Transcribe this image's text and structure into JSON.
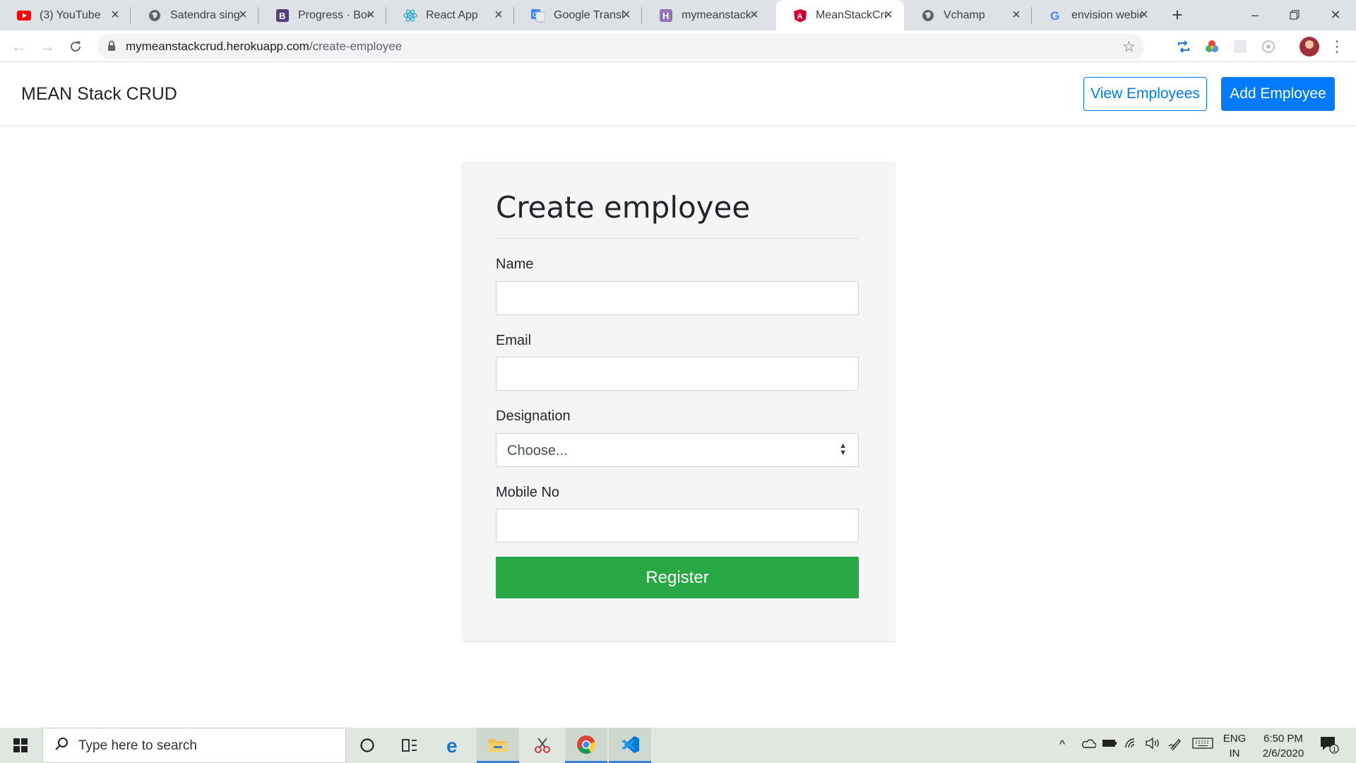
{
  "browser": {
    "tabs": [
      {
        "title": "(3) YouTube",
        "icon": "youtube-icon"
      },
      {
        "title": "Satendra singh",
        "icon": "globe-icon"
      },
      {
        "title": "Progress · Boot",
        "icon": "bootstrap-icon"
      },
      {
        "title": "React App",
        "icon": "react-icon"
      },
      {
        "title": "Google Translat",
        "icon": "google-translate-icon"
      },
      {
        "title": "mymeanstackcr",
        "icon": "heroku-icon"
      },
      {
        "title": "MeanStackCrud",
        "icon": "angular-icon"
      },
      {
        "title": "Vchamp",
        "icon": "globe-icon"
      },
      {
        "title": "envision webie",
        "icon": "google-icon"
      }
    ],
    "active_tab_index": 6,
    "url_host": "mymeanstackcrud.herokuapp.com",
    "url_path": "/create-employee"
  },
  "app": {
    "brand": "MEAN Stack CRUD",
    "nav": {
      "view_employees": "View Employees",
      "add_employee": "Add Employee"
    },
    "form": {
      "title": "Create employee",
      "name_label": "Name",
      "name_value": "",
      "email_label": "Email",
      "email_value": "",
      "designation_label": "Designation",
      "designation_selected": "Choose...",
      "mobile_label": "Mobile No",
      "mobile_value": "",
      "submit_label": "Register"
    }
  },
  "taskbar": {
    "search_placeholder": "Type here to search",
    "lang_line1": "ENG",
    "lang_line2": "IN",
    "time": "6:50 PM",
    "date": "2/6/2020",
    "notification_count": "1"
  },
  "colors": {
    "primary": "#007bff",
    "success": "#28a745",
    "card_bg": "#f5f5f5"
  }
}
